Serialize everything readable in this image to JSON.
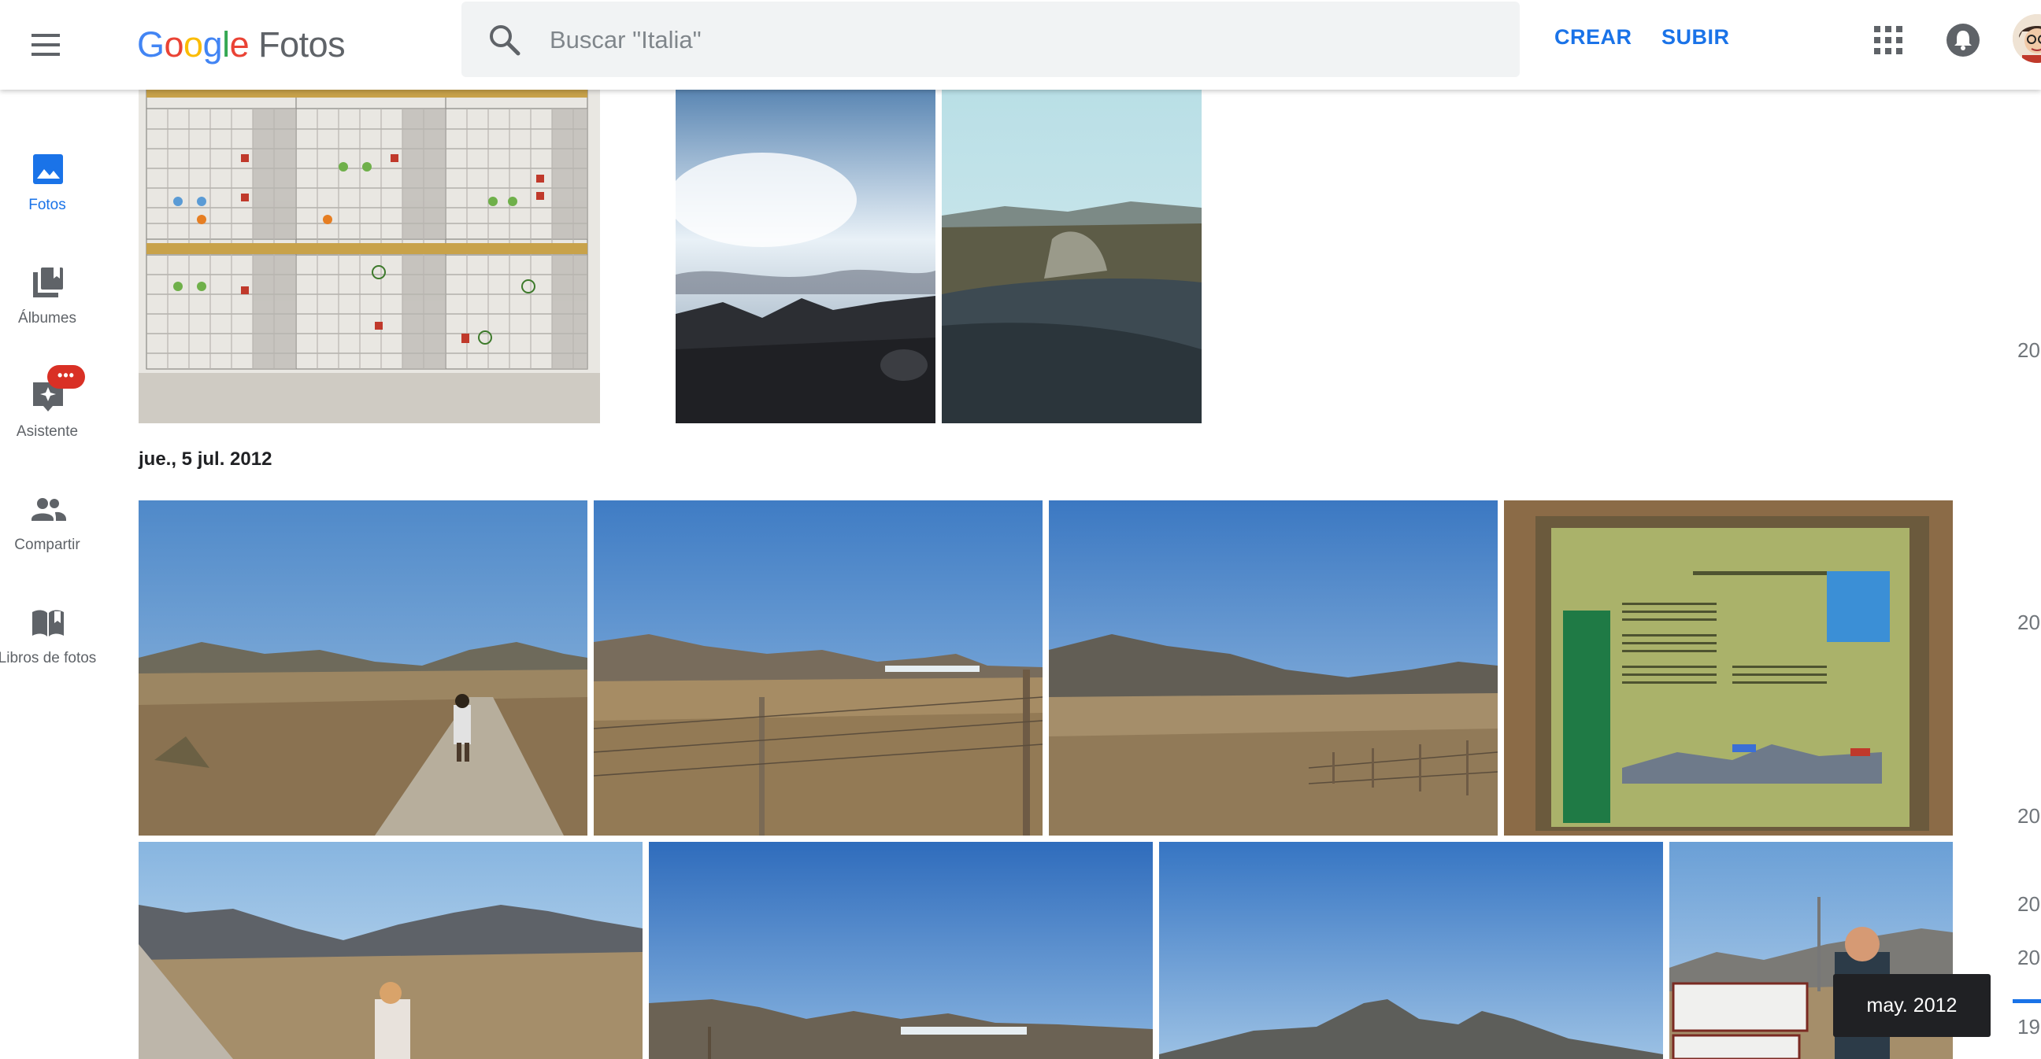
{
  "app": {
    "logo_google": [
      "G",
      "o",
      "o",
      "g",
      "l",
      "e"
    ],
    "logo_colors": [
      "#4285F4",
      "#EA4335",
      "#FBBC05",
      "#4285F4",
      "#34A853",
      "#EA4335"
    ],
    "product_name": "Fotos",
    "accent": "#1a73e8"
  },
  "search": {
    "placeholder": "Buscar \"Italia\""
  },
  "header_actions": {
    "create_label": "CREAR",
    "upload_label": "SUBIR"
  },
  "icons": {
    "menu": "hamburger-menu-icon",
    "search": "search-icon",
    "apps": "apps-grid-icon",
    "notifications": "bell-icon",
    "photos": "photo-icon",
    "albums": "albums-icon",
    "assistant": "assistant-icon",
    "sharing": "people-icon",
    "photo_books": "book-icon"
  },
  "sidebar": {
    "items": [
      {
        "label": "Fotos",
        "active": true
      },
      {
        "label": "Álbumes"
      },
      {
        "label": "Asistente",
        "badge": "•••"
      },
      {
        "label": "Compartir"
      },
      {
        "label": "Libros de fotos"
      }
    ]
  },
  "sections": [
    {
      "date": "jue., 5 jul. 2012"
    }
  ],
  "scrubber": {
    "labels": [
      "20",
      "20",
      "20",
      "20",
      "20",
      "19"
    ],
    "tooltip": "may. 2012"
  }
}
